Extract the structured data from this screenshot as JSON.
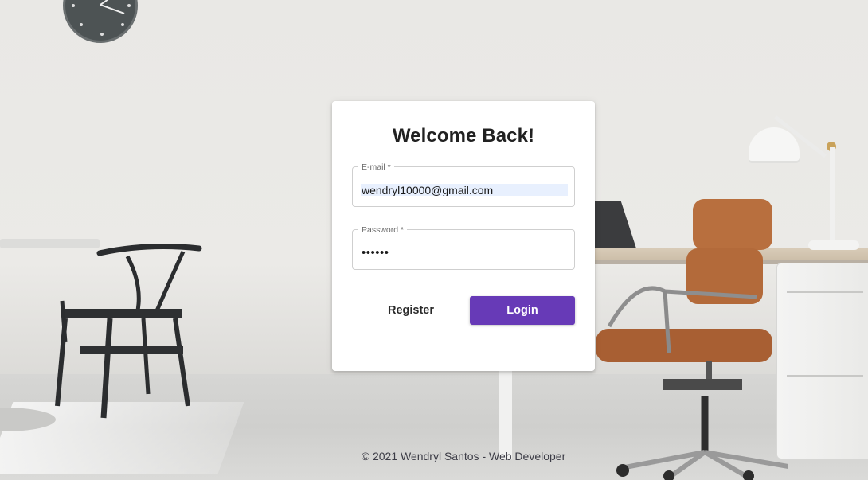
{
  "login": {
    "title": "Welcome Back!",
    "email": {
      "label": "E-mail *",
      "value": "wendryl10000@gmail.com"
    },
    "password": {
      "label": "Password *",
      "value": "••••••"
    },
    "register_label": "Register",
    "login_label": "Login"
  },
  "footer": {
    "text": "© 2021 Wendryl Santos - Web Developer"
  },
  "colors": {
    "primary": "#673ab7"
  },
  "icons": {
    "background": "office-photo-background"
  }
}
